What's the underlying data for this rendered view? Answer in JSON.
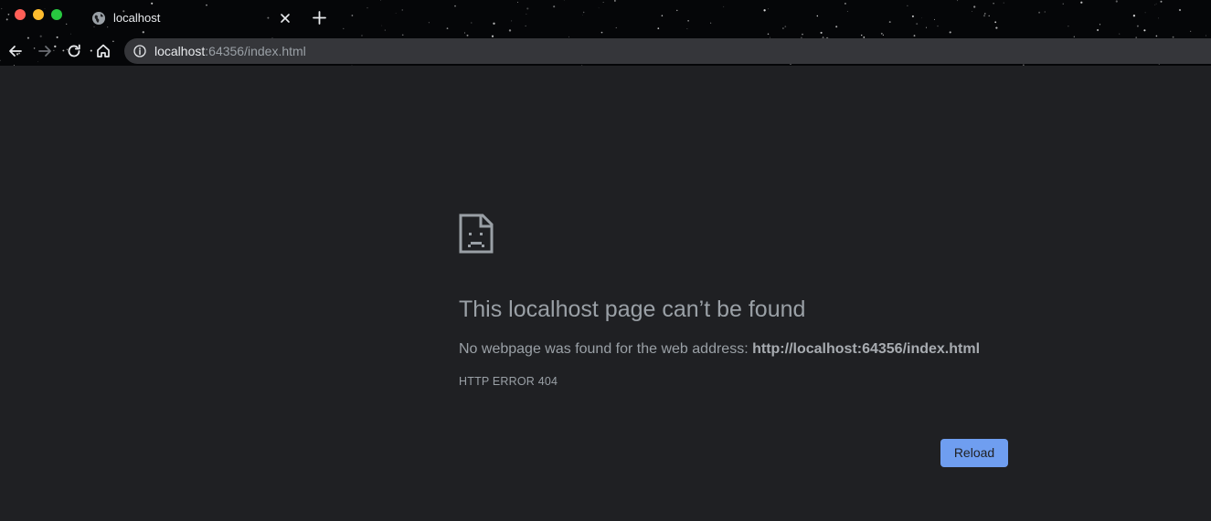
{
  "window": {
    "traffic_lights": [
      "close",
      "minimize",
      "maximize"
    ],
    "colors": {
      "close": "#ff5f57",
      "minimize": "#febc2e",
      "maximize": "#28c840"
    }
  },
  "tab": {
    "title": "localhost",
    "favicon": "globe-icon",
    "close_icon": "close-icon"
  },
  "toolbar": {
    "back_icon": "arrow-left-icon",
    "forward_icon": "arrow-right-icon",
    "reload_icon": "reload-icon",
    "home_icon": "home-icon",
    "new_tab_icon": "plus-icon"
  },
  "omnibox": {
    "info_icon": "info-icon",
    "host": "localhost",
    "rest": ":64356/index.html"
  },
  "error": {
    "icon": "sad-page-icon",
    "title": "This localhost page can’t be found",
    "desc_prefix": "No webpage was found for the web address: ",
    "desc_url": "http://localhost:64356/index.html",
    "code": "HTTP ERROR 404",
    "reload_label": "Reload"
  },
  "colors": {
    "page_background": "#1f2023",
    "accent_button": "#8ab4f8",
    "text_secondary": "#9aa0a6"
  }
}
